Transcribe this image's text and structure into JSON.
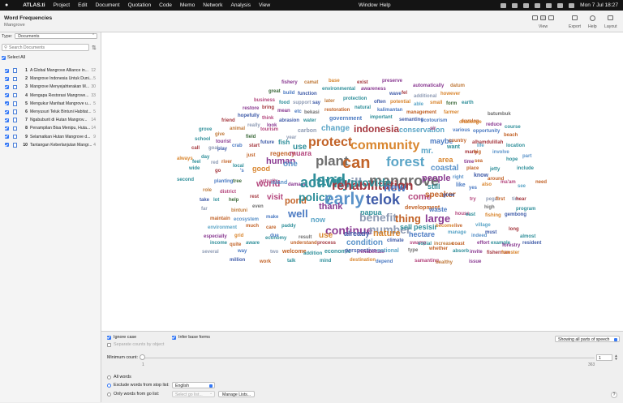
{
  "menubar": {
    "app_name": "ATLAS.ti",
    "items": [
      "Project",
      "Edit",
      "Document",
      "Quotation",
      "Code",
      "Memo",
      "Network",
      "Analysis",
      "View"
    ],
    "window": "Window",
    "help": "Help",
    "clock": "Mon 7 Jul  18:27"
  },
  "window": {
    "title": "Word Frequencies",
    "subtitle": "Mangrove"
  },
  "toolbar": {
    "view_label": "View",
    "export_label": "Export",
    "help_label": "Help",
    "layout_label": "Layout"
  },
  "sidebar": {
    "type_label": "Type:",
    "type_value": "Documents",
    "search_placeholder": "Search Documents",
    "select_all_label": "Select All",
    "documents": [
      {
        "num": "1",
        "name": "A Global Mangrove Alliance in...",
        "count": "12"
      },
      {
        "num": "2",
        "name": "Mangrove Indonesia Untuk Duni...",
        "count": "5"
      },
      {
        "num": "3",
        "name": "Mangrove Menyejahterakan M...",
        "count": "30"
      },
      {
        "num": "4",
        "name": "Mengapa Restorasi Mangrove...",
        "count": "33"
      },
      {
        "num": "5",
        "name": "Mengukur Manfaat Mangrove u...",
        "count": "5"
      },
      {
        "num": "6",
        "name": "Menyusuri Teluk Bintuni Habitat...",
        "count": "5"
      },
      {
        "num": "7",
        "name": "Ngabuburit di Hutan Mangrov...",
        "count": "14"
      },
      {
        "num": "8",
        "name": "Penampilan Bisa Menipu, Huta...",
        "count": "14"
      },
      {
        "num": "9",
        "name": "Selamatkan Hutan Mangrove d...",
        "count": "9"
      },
      {
        "num": "10",
        "name": "Tantangan Keberlanjutan Mangr...",
        "count": "4"
      }
    ]
  },
  "colors": {
    "accent": "#3478f6",
    "word_palette": [
      "#3f5ba8",
      "#4b7ac2",
      "#5a92c9",
      "#2f8f9a",
      "#c26328",
      "#d9862f",
      "#b4467d",
      "#8a3b92",
      "#6e6e6e",
      "#8e9bb4",
      "#5ba5c7",
      "#c07a3a",
      "#a5383f",
      "#3d6b3c"
    ]
  },
  "word_cloud": [
    {
      "t": "fishery",
      "c": 7
    },
    {
      "t": "camat",
      "c": 11
    },
    {
      "t": "base",
      "c": 5
    },
    {
      "t": "exist",
      "c": 12
    },
    {
      "t": "preserve",
      "c": 7
    },
    {
      "t": "automatically",
      "c": 7
    },
    {
      "t": "datum",
      "c": 11
    },
    {
      "t": "great",
      "c": 13
    },
    {
      "t": "build",
      "c": 1
    },
    {
      "t": "function",
      "c": 0
    },
    {
      "t": "environmental",
      "c": 3
    },
    {
      "t": "awareness",
      "c": 7
    },
    {
      "t": "wave",
      "c": 0
    },
    {
      "t": "fel",
      "c": 12
    },
    {
      "t": "additional",
      "c": 9
    },
    {
      "t": "however",
      "c": 5
    },
    {
      "t": "business",
      "c": 6
    },
    {
      "t": "food",
      "c": 3
    },
    {
      "t": "support",
      "c": 9
    },
    {
      "t": "say",
      "c": 0
    },
    {
      "t": "later",
      "c": 11
    },
    {
      "t": "protection",
      "c": 3
    },
    {
      "t": "often",
      "c": 0
    },
    {
      "t": "potential",
      "c": 5
    },
    {
      "t": "able",
      "c": 10
    },
    {
      "t": "small",
      "c": 5
    },
    {
      "t": "form",
      "c": 13
    },
    {
      "t": "earth",
      "c": 3
    },
    {
      "t": "restore",
      "c": 7
    },
    {
      "t": "bring",
      "c": 12
    },
    {
      "t": "mean",
      "c": 7
    },
    {
      "t": "etc",
      "c": 1
    },
    {
      "t": "bekasi",
      "c": 8
    },
    {
      "t": "restoration",
      "c": 4
    },
    {
      "t": "natural",
      "c": 3
    },
    {
      "t": "kalimantan",
      "c": 1
    },
    {
      "t": "management",
      "c": 4
    },
    {
      "t": "farmer",
      "c": 5
    },
    {
      "t": "hopefully",
      "c": 0
    },
    {
      "t": "think",
      "c": 6
    },
    {
      "t": "abrasion",
      "c": 0
    },
    {
      "t": "water",
      "c": 3
    },
    {
      "t": "government",
      "c": 1
    },
    {
      "t": "important",
      "c": 3
    },
    {
      "t": "semanting",
      "c": 0
    },
    {
      "t": "ecotourism",
      "c": 1
    },
    {
      "t": "develop",
      "c": 4
    },
    {
      "t": "batumbuk",
      "c": 8
    },
    {
      "t": "friend",
      "c": 12
    },
    {
      "t": "really",
      "c": 9
    },
    {
      "t": "look",
      "c": 7
    },
    {
      "t": "challenge",
      "c": 5
    },
    {
      "t": "reduce",
      "c": 7
    },
    {
      "t": "animal",
      "c": 11
    },
    {
      "t": "tourism",
      "c": 6
    },
    {
      "t": "carbon",
      "c": 9
    },
    {
      "t": "change",
      "c": 10
    },
    {
      "t": "indonesia",
      "c": 12
    },
    {
      "t": "conservation",
      "c": 10
    },
    {
      "t": "sir",
      "c": 6
    },
    {
      "t": "various",
      "c": 1
    },
    {
      "t": "opportunity",
      "c": 1
    },
    {
      "t": "course",
      "c": 3
    },
    {
      "t": "grove",
      "c": 3
    },
    {
      "t": "give",
      "c": 11
    },
    {
      "t": "field",
      "c": 13
    },
    {
      "t": "year",
      "c": 9
    },
    {
      "t": "beach",
      "c": 4
    },
    {
      "t": "school",
      "c": 3
    },
    {
      "t": "tourist",
      "c": 7
    },
    {
      "t": "future",
      "c": 0
    },
    {
      "t": "fish",
      "c": 3
    },
    {
      "t": "maybe",
      "c": 1
    },
    {
      "t": "country",
      "c": 4
    },
    {
      "t": "alhamdulillah",
      "c": 12
    },
    {
      "t": "call",
      "c": 12
    },
    {
      "t": "goal",
      "c": 9
    },
    {
      "t": "play",
      "c": 0
    },
    {
      "t": "crab",
      "c": 1
    },
    {
      "t": "start",
      "c": 12
    },
    {
      "t": "use",
      "c": 3
    },
    {
      "t": "protect",
      "c": 4
    },
    {
      "t": "community",
      "c": 5
    },
    {
      "t": "mr.",
      "c": 10
    },
    {
      "t": "want",
      "c": 3
    },
    {
      "t": "life",
      "c": 10
    },
    {
      "t": "location",
      "c": 3
    },
    {
      "t": "always",
      "c": 5
    },
    {
      "t": "day",
      "c": 3
    },
    {
      "t": "just",
      "c": 4
    },
    {
      "t": "regency",
      "c": 4
    },
    {
      "t": "muara",
      "c": 6
    },
    {
      "t": "many",
      "c": 12
    },
    {
      "t": "big",
      "c": 4
    },
    {
      "t": "involve",
      "c": 2
    },
    {
      "t": "feel",
      "c": 3
    },
    {
      "t": "red",
      "c": 9
    },
    {
      "t": "river",
      "c": 4
    },
    {
      "t": "local",
      "c": 3
    },
    {
      "t": "human",
      "c": 7
    },
    {
      "t": "plant",
      "c": 8
    },
    {
      "t": "can",
      "c": 4
    },
    {
      "t": "forest",
      "c": 10
    },
    {
      "t": "area",
      "c": 5
    },
    {
      "t": "time",
      "c": 7
    },
    {
      "t": "sea",
      "c": 4
    },
    {
      "t": "hope",
      "c": 3
    },
    {
      "t": "part",
      "c": 2
    },
    {
      "t": "wide",
      "c": 3
    },
    {
      "t": "go",
      "c": 12
    },
    {
      "t": "'s",
      "c": 1
    },
    {
      "t": "good",
      "c": 5
    },
    {
      "t": "one",
      "c": 2
    },
    {
      "t": "coastal",
      "c": 2
    },
    {
      "t": "place",
      "c": 4
    },
    {
      "t": "jetty",
      "c": 3
    },
    {
      "t": "include",
      "c": 3
    },
    {
      "t": "second",
      "c": 3
    },
    {
      "t": "planting",
      "c": 1
    },
    {
      "t": "tree",
      "c": 13
    },
    {
      "t": "actually",
      "c": 6
    },
    {
      "t": "land",
      "c": 3
    },
    {
      "t": "will",
      "c": 9
    },
    {
      "t": "mangrove",
      "c": 8
    },
    {
      "t": "people",
      "c": 7
    },
    {
      "t": "right",
      "c": 2
    },
    {
      "t": "know",
      "c": 0
    },
    {
      "t": "around",
      "c": 4
    },
    {
      "t": "role",
      "c": 11
    },
    {
      "t": "district",
      "c": 6
    },
    {
      "t": "world",
      "c": 6
    },
    {
      "t": "island",
      "c": 2
    },
    {
      "t": "damage",
      "c": 7
    },
    {
      "t": "activity",
      "c": 3
    },
    {
      "t": "rehabilitation",
      "c": 12
    },
    {
      "t": "provide",
      "c": 3
    },
    {
      "t": "new",
      "c": 1
    },
    {
      "t": "still",
      "c": 3
    },
    {
      "t": "like",
      "c": 1
    },
    {
      "t": "yes",
      "c": 1
    },
    {
      "t": "also",
      "c": 5
    },
    {
      "t": "ma'am",
      "c": 6
    },
    {
      "t": "see",
      "c": 10
    },
    {
      "t": "need",
      "c": 4
    },
    {
      "t": "take",
      "c": 0
    },
    {
      "t": "lot",
      "c": 3
    },
    {
      "t": "help",
      "c": 13
    },
    {
      "t": "rest",
      "c": 12
    },
    {
      "t": "visit",
      "c": 6
    },
    {
      "t": "pond",
      "c": 4
    },
    {
      "t": "policy",
      "c": 3
    },
    {
      "t": "early",
      "c": 2
    },
    {
      "t": "telok",
      "c": 0
    },
    {
      "t": "come",
      "c": 6
    },
    {
      "t": "speaker",
      "c": 4
    },
    {
      "t": "grow",
      "c": 0
    },
    {
      "t": "try",
      "c": 6
    },
    {
      "t": "pegat",
      "c": 9
    },
    {
      "t": "first",
      "c": 4
    },
    {
      "t": "tim",
      "c": 9
    },
    {
      "t": "hear",
      "c": 12
    },
    {
      "t": "far",
      "c": 9
    },
    {
      "t": "bintuni",
      "c": 11
    },
    {
      "t": "even",
      "c": 8
    },
    {
      "t": "well",
      "c": 1
    },
    {
      "t": "thank",
      "c": 7
    },
    {
      "t": "papua",
      "c": 3
    },
    {
      "t": "development",
      "c": 4
    },
    {
      "t": "waste",
      "c": 1
    },
    {
      "t": "high",
      "c": 8
    },
    {
      "t": "program",
      "c": 3
    },
    {
      "t": "maintain",
      "c": 4
    },
    {
      "t": "ecosystem",
      "c": 2
    },
    {
      "t": "make",
      "c": 1
    },
    {
      "t": "now",
      "c": 10
    },
    {
      "t": "benefit",
      "c": 9
    },
    {
      "t": "thing",
      "c": 4
    },
    {
      "t": "large",
      "c": 7
    },
    {
      "t": "house",
      "c": 6
    },
    {
      "t": "east",
      "c": 3
    },
    {
      "t": "fishing",
      "c": 5
    },
    {
      "t": "gembong",
      "c": 0
    },
    {
      "t": "environment",
      "c": 10
    },
    {
      "t": "much",
      "c": 4
    },
    {
      "t": "care",
      "c": 4
    },
    {
      "t": "paddy",
      "c": 3
    },
    {
      "t": "continue",
      "c": 7
    },
    {
      "t": "number",
      "c": 9
    },
    {
      "t": "sell",
      "c": 3
    },
    {
      "t": "pesisir",
      "c": 3
    },
    {
      "t": "become",
      "c": 5
    },
    {
      "t": "live",
      "c": 4
    },
    {
      "t": "village",
      "c": 10
    },
    {
      "t": "especially",
      "c": 7
    },
    {
      "t": "grid",
      "c": 5
    },
    {
      "t": "economy",
      "c": 3
    },
    {
      "t": "due",
      "c": 1
    },
    {
      "t": "result",
      "c": 8
    },
    {
      "t": "use",
      "c": 5
    },
    {
      "t": "already",
      "c": 0
    },
    {
      "t": "nature",
      "c": 5
    },
    {
      "t": "hectare",
      "c": 1
    },
    {
      "t": "manage",
      "c": 10
    },
    {
      "t": "indeed",
      "c": 2
    },
    {
      "t": "must",
      "c": 0
    },
    {
      "t": "long",
      "c": 12
    },
    {
      "t": "almost",
      "c": 3
    },
    {
      "t": "income",
      "c": 3
    },
    {
      "t": "quite",
      "c": 4
    },
    {
      "t": "aware",
      "c": 3
    },
    {
      "t": "understand",
      "c": 4
    },
    {
      "t": "process",
      "c": 12
    },
    {
      "t": "condition",
      "c": 2
    },
    {
      "t": "climate",
      "c": 0
    },
    {
      "t": "swamp",
      "c": 6
    },
    {
      "t": "social",
      "c": 3
    },
    {
      "t": "increase",
      "c": 11
    },
    {
      "t": "coast",
      "c": 4
    },
    {
      "t": "effort",
      "c": 7
    },
    {
      "t": "example",
      "c": 3
    },
    {
      "t": "forestry",
      "c": 7
    },
    {
      "t": "resident",
      "c": 0
    },
    {
      "t": "several",
      "c": 9
    },
    {
      "t": "way",
      "c": 1
    },
    {
      "t": "two",
      "c": 9
    },
    {
      "t": "welcome",
      "c": 4
    },
    {
      "t": "addition",
      "c": 3
    },
    {
      "t": "economic",
      "c": 3
    },
    {
      "t": "perspective",
      "c": 0
    },
    {
      "t": "rehabilitate",
      "c": 7
    },
    {
      "t": "national",
      "c": 10
    },
    {
      "t": "type",
      "c": 8
    },
    {
      "t": "whether",
      "c": 4
    },
    {
      "t": "absorb",
      "c": 3
    },
    {
      "t": "invite",
      "c": 7
    },
    {
      "t": "fisherman",
      "c": 12
    },
    {
      "t": "forester",
      "c": 5
    },
    {
      "t": "million",
      "c": 0
    },
    {
      "t": "work",
      "c": 4
    },
    {
      "t": "talk",
      "c": 3
    },
    {
      "t": "mind",
      "c": 3
    },
    {
      "t": "destination",
      "c": 5
    },
    {
      "t": "depend",
      "c": 1
    },
    {
      "t": "samanting",
      "c": 6
    },
    {
      "t": "healthy",
      "c": 11
    },
    {
      "t": "issue",
      "c": 7
    }
  ],
  "options": {
    "ignore_case": "Ignore case",
    "infer_base_forms": "Infer base forms",
    "separate_counts": "Separate counts by object",
    "parts_of_speech": "Showing all parts of speech",
    "min_count_label": "Minimum count:",
    "min_value": "1",
    "slider_min": "1",
    "slider_max": "363",
    "slider_level": 0,
    "all_words": "All words",
    "exclude_words": "Exclude words from stop list:",
    "stop_list": "English",
    "only_words": "Only words from go list:",
    "go_list_placeholder": "Select go list...",
    "manage_lists": "Manage Lists...",
    "help_symbol": "?"
  }
}
